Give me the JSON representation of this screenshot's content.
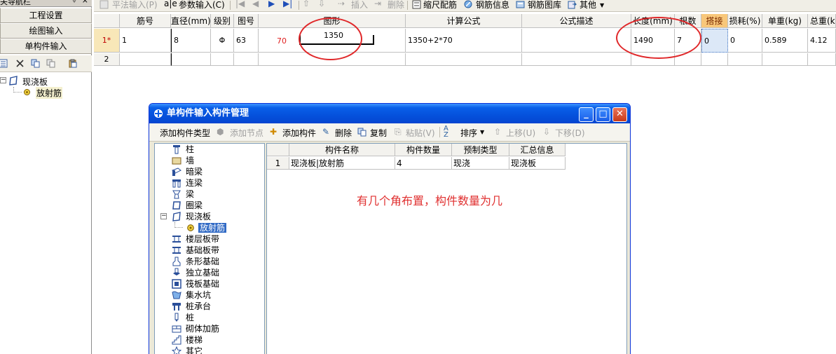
{
  "nav": {
    "title": "关导航栏",
    "pin": "ᛰ",
    "close": "×",
    "buttons": [
      "工程设置",
      "绘图输入",
      "单构件输入"
    ],
    "tree": {
      "root": "现浇板",
      "child": "放射筋"
    }
  },
  "toolbar": {
    "items": [
      {
        "label": "平法输入(P)",
        "enabled": false
      },
      {
        "label": "参数输入(C)",
        "enabled": true
      },
      {
        "label": "插入",
        "enabled": false
      },
      {
        "label": "删除",
        "enabled": false
      },
      {
        "label": "缩尺配筋",
        "enabled": true
      },
      {
        "label": "钢筋信息",
        "enabled": true
      },
      {
        "label": "钢筋图库",
        "enabled": true
      },
      {
        "label": "其他",
        "enabled": true
      }
    ]
  },
  "grid": {
    "headers": [
      "筋号",
      "直径(mm)",
      "级别",
      "图号",
      "图形",
      "计算公式",
      "公式描述",
      "长度(mm)",
      "根数",
      "搭接",
      "损耗(%)",
      "单重(kg)",
      "总重(k"
    ],
    "rows": [
      {
        "num": "1*",
        "bar_no": "1",
        "diameter": "8",
        "grade": "Φ",
        "figure_no": "63",
        "shape_left": "70",
        "shape_mid": "1350",
        "formula": "1350+2*70",
        "formula_desc": "",
        "length": "1490",
        "count": "7",
        "lap": "0",
        "loss": "0",
        "unit_weight": "0.589",
        "total_weight": "4.12"
      },
      {
        "num": "2"
      }
    ]
  },
  "dialog": {
    "title": "单构件输入构件管理",
    "toolbar": [
      {
        "label": "添加构件类型",
        "enabled": true
      },
      {
        "label": "添加节点",
        "enabled": false
      },
      {
        "label": "添加构件",
        "enabled": true
      },
      {
        "label": "删除",
        "enabled": true
      },
      {
        "label": "复制",
        "enabled": true
      },
      {
        "label": "粘贴(V)",
        "enabled": false
      },
      {
        "label": "排序",
        "enabled": true
      },
      {
        "label": "上移(U)",
        "enabled": false
      },
      {
        "label": "下移(D)",
        "enabled": false
      }
    ],
    "tree": [
      "柱",
      "墙",
      "暗梁",
      "连梁",
      "梁",
      "圈梁",
      "现浇板",
      "放射筋",
      "楼层板带",
      "基础板带",
      "条形基础",
      "独立基础",
      "筏板基础",
      "集水坑",
      "桩承台",
      "桩",
      "砌体加筋",
      "楼梯",
      "其它"
    ],
    "list": {
      "headers": [
        "构件名称",
        "构件数量",
        "预制类型",
        "汇总信息"
      ],
      "rows": [
        {
          "num": "1",
          "name": "现浇板|放射筋",
          "qty": "4",
          "type": "现浇",
          "summary": "现浇板"
        }
      ]
    },
    "note": "有几个角布置，构件数量为几"
  },
  "colors": {
    "accent": "#0551dc",
    "annotation": "#e0282a",
    "highlight_header": "#f8c77a"
  }
}
